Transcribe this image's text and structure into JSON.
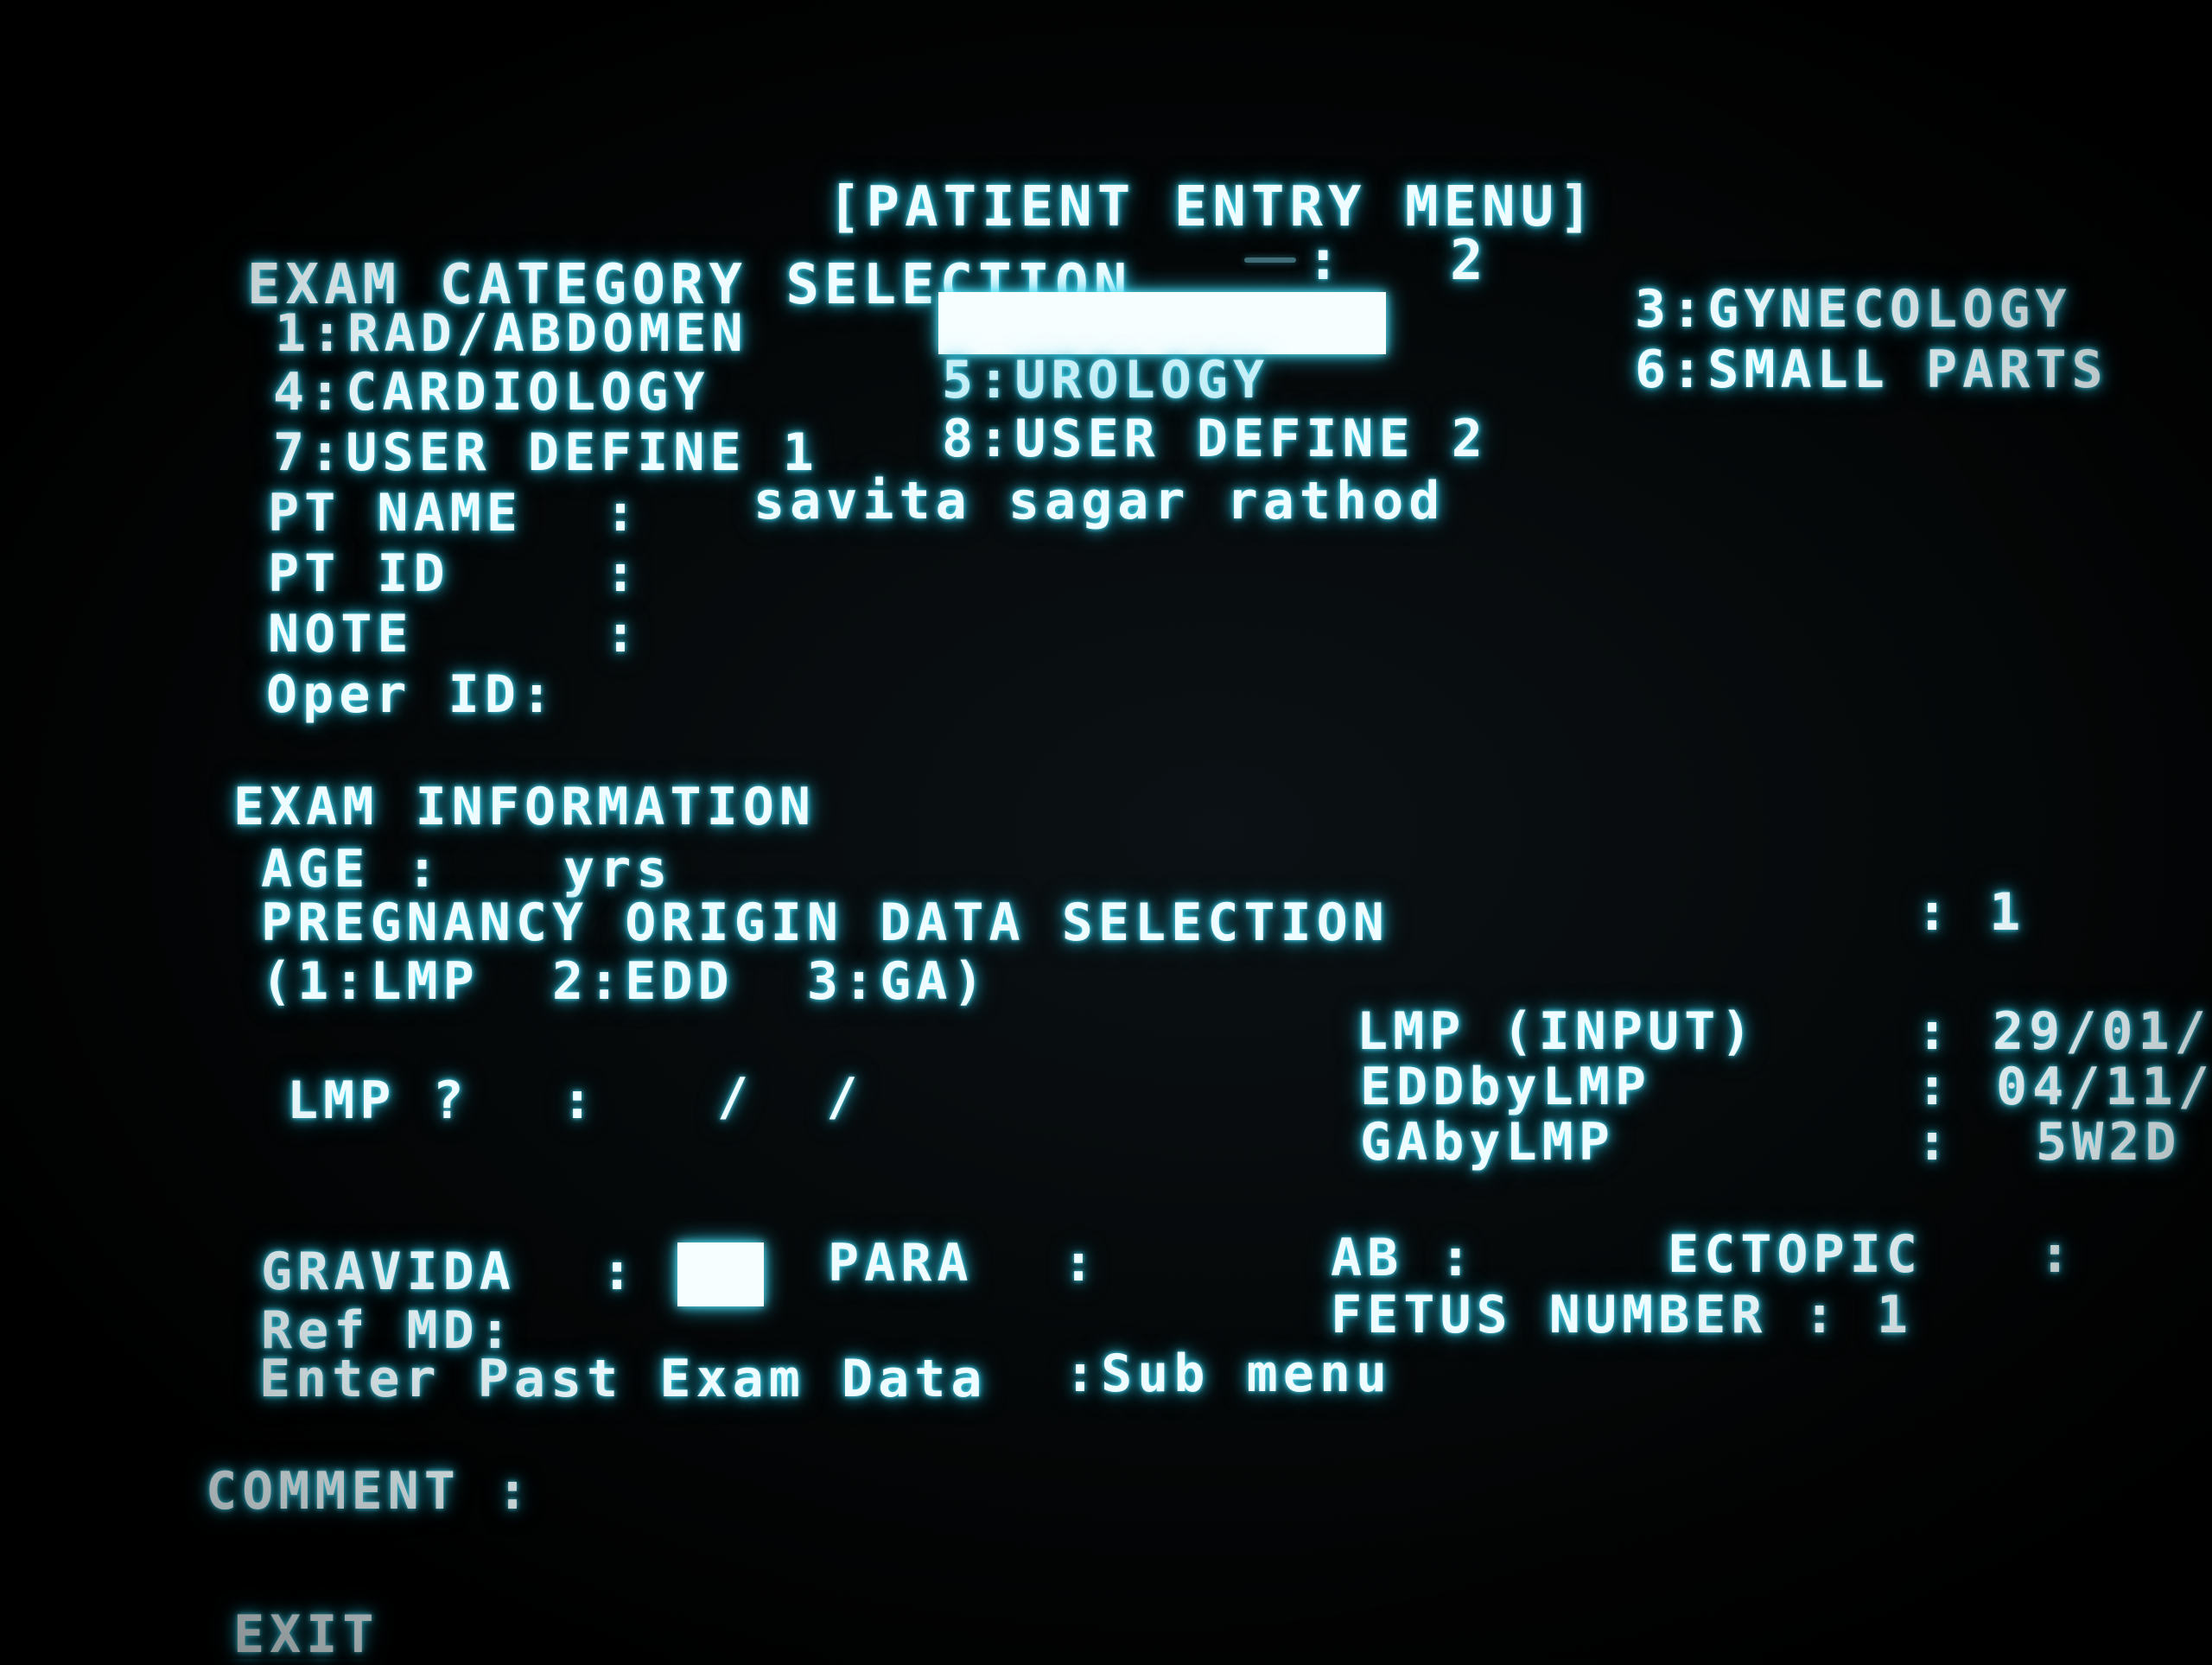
{
  "header": {
    "title": "[PATIENT ENTRY MENU]"
  },
  "exam_category": {
    "label": "EXAM CATEGORY SELECTION",
    "separator": ":",
    "value": "2",
    "options": [
      "1:RAD/ABDOMEN",
      "3:GYNECOLOGY",
      "4:CARDIOLOGY",
      "5:UROLOGY",
      "6:SMALL PARTS",
      "7:USER DEFINE 1",
      "8:USER DEFINE 2"
    ]
  },
  "patient": {
    "name_label": "PT NAME",
    "name_value": "savita sagar rathod",
    "id_label": "PT ID",
    "note_label": "NOTE",
    "oper_label": "Oper ID:",
    "colon": ":"
  },
  "exam_info": {
    "heading": "EXAM INFORMATION",
    "age_label": "AGE :",
    "age_unit": "yrs",
    "pregnancy_label": "PREGNANCY ORIGIN DATA SELECTION",
    "pregnancy_value": ": 1",
    "pregnancy_options": "(1:LMP  2:EDD  3:GA)",
    "lmp_question": "LMP ?",
    "lmp_colon": ":",
    "lmp_date": "/  /",
    "lmp_input_label": "LMP (INPUT)",
    "lmp_input_value": "29/01/",
    "edd_label": "EDDbyLMP",
    "edd_value": "04/11/",
    "ga_label": "GAbyLMP",
    "ga_value": "5W2D",
    "result_colon": ":"
  },
  "obstetric": {
    "gravida_label": "GRAVIDA",
    "para_label": "PARA",
    "ab_label": "AB :",
    "ectopic_label": "ECTOPIC",
    "fetus_label": "FETUS NUMBER : 1",
    "refmd_label": "Ref MD:",
    "past_exam_label": "Enter Past Exam Data",
    "submenu_label": ":Sub menu",
    "colon": ":"
  },
  "comment": {
    "label": "COMMENT :"
  },
  "footer": {
    "exit_label": "EXIT"
  }
}
